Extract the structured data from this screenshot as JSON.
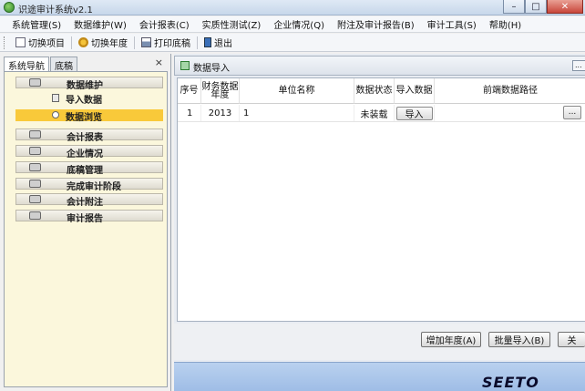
{
  "window": {
    "title": "识途审计系统v2.1"
  },
  "menu": [
    "系统管理(S)",
    "数据维护(W)",
    "会计报表(C)",
    "实质性测试(Z)",
    "企业情况(Q)",
    "附注及审计报告(B)",
    "审计工具(S)",
    "帮助(H)"
  ],
  "toolbar": {
    "switch_project": "切换项目",
    "switch_year": "切换年度",
    "print_draft": "打印底稿",
    "exit": "退出"
  },
  "left": {
    "tabs": [
      "系统导航",
      "底稿"
    ],
    "close": "×",
    "groups": [
      {
        "label": "数据维护",
        "icon": "database-icon"
      },
      {
        "label": "会计报表",
        "icon": "report-icon"
      },
      {
        "label": "企业情况",
        "icon": "enterprise-icon"
      },
      {
        "label": "底稿管理",
        "icon": "cart-icon"
      },
      {
        "label": "完成审计阶段",
        "icon": "coins-icon"
      },
      {
        "label": "会计附注",
        "icon": "note-icon"
      },
      {
        "label": "审计报告",
        "icon": "report-stack-icon"
      }
    ],
    "subs": [
      {
        "label": "导入数据",
        "icon": "import-icon"
      },
      {
        "label": "数据浏览",
        "icon": "browse-icon",
        "selected": true
      }
    ]
  },
  "panel": {
    "title": "数据导入",
    "columns": [
      "序号",
      "财务数据年度",
      "单位名称",
      "数据状态",
      "导入数据",
      "前端数据路径"
    ],
    "rows": [
      {
        "seq": "1",
        "year": "2013",
        "unit": "1",
        "status": "未装载",
        "import_btn": "导入",
        "path": "",
        "browse": "..."
      }
    ],
    "buttons": {
      "add_year": "增加年度(A)",
      "batch_import": "批量导入(B)",
      "close": "关"
    }
  },
  "footer": {
    "logo": "SEETO"
  },
  "colors": {
    "selected_nav": "#f9c93a",
    "nav_bg": "#fbf7dc",
    "footer": "#b3ccec"
  }
}
